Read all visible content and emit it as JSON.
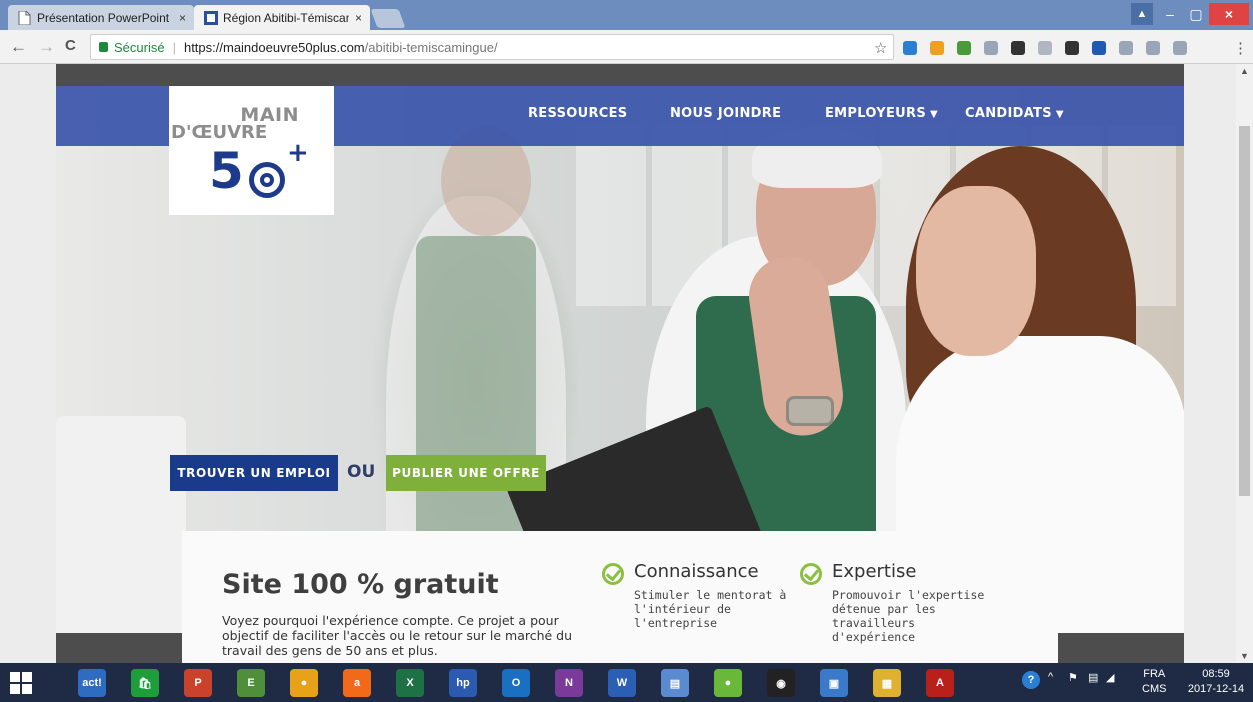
{
  "browser": {
    "tabs": [
      {
        "label": "Présentation PowerPoint",
        "close": "×",
        "active": false
      },
      {
        "label": "Région Abitibi-Témiscam",
        "close": "×",
        "active": true
      }
    ],
    "window_controls": {
      "profile": "▲",
      "minimize": "–",
      "maximize": "▢",
      "close": "×"
    },
    "nav": {
      "back": "←",
      "forward": "→",
      "reload": "C"
    },
    "address": {
      "secure_label": "Sécurisé",
      "separator": "|",
      "url_host": "https://maindoeuvre50plus.com",
      "url_path": "/abitibi-temiscamingue/"
    },
    "bookmark_icon": "☆",
    "menu_icon": "⋮",
    "extension_colors": [
      "#2a7fd4",
      "#f0a020",
      "#4a9a3a",
      "#9aa6b8",
      "#333333",
      "#b0b7c2",
      "#333333",
      "#1e5ab4",
      "#9aa6b8",
      "#9aa6b8",
      "#9aa6b8"
    ]
  },
  "site": {
    "logo": {
      "line1": "MAIN",
      "line2": "D'ŒUVRE",
      "number": "5",
      "plus": "+"
    },
    "nav": [
      {
        "label": "RESSOURCES",
        "has_dropdown": false
      },
      {
        "label": "NOUS JOINDRE",
        "has_dropdown": false
      },
      {
        "label": "EMPLOYEURS",
        "has_dropdown": true
      },
      {
        "label": "CANDIDATS",
        "has_dropdown": true
      }
    ],
    "caret": "▼",
    "cta": {
      "find_job": "TROUVER UN EMPLOI",
      "or": "OU",
      "publish_offer": "PUBLIER UNE OFFRE"
    },
    "card": {
      "title": "Site 100 % gratuit",
      "description": "Voyez pourquoi l'expérience compte. Ce projet a pour objectif de faciliter l'accès ou le retour sur le marché du travail des gens de 50 ans et plus.",
      "features": [
        {
          "name": "Connaissance",
          "description": "Stimuler le mentorat à l'intérieur de l'entreprise"
        },
        {
          "name": "Expertise",
          "description": "Promouvoir l'expertise détenue par les travailleurs d'expérience"
        }
      ]
    },
    "colors": {
      "nav_blue": "#3a54aa",
      "find_button": "#1a3a8c",
      "publish_button": "#7fb03b",
      "check_green": "#8bbf3f"
    }
  },
  "scrollbar": {
    "up": "▲",
    "down": "▼"
  },
  "taskbar": {
    "apps": [
      {
        "name": "act",
        "label": "act!",
        "color": "#2d6cc0"
      },
      {
        "name": "store",
        "label": "🛍",
        "color": "#1e9e3a"
      },
      {
        "name": "powerpoint",
        "label": "P",
        "color": "#c9422b"
      },
      {
        "name": "evernote",
        "label": "E",
        "color": "#4f8f3a"
      },
      {
        "name": "chrome",
        "label": "●",
        "color": "#e8a21a"
      },
      {
        "name": "avast",
        "label": "a",
        "color": "#f06a1a"
      },
      {
        "name": "excel",
        "label": "X",
        "color": "#1e7145"
      },
      {
        "name": "hp",
        "label": "hp",
        "color": "#2a5bb0"
      },
      {
        "name": "outlook",
        "label": "O",
        "color": "#1a6fc0"
      },
      {
        "name": "onenote",
        "label": "N",
        "color": "#7a3a9a"
      },
      {
        "name": "word",
        "label": "W",
        "color": "#2b5fb4"
      },
      {
        "name": "documents",
        "label": "▤",
        "color": "#5a8ad0"
      },
      {
        "name": "messenger",
        "label": "●",
        "color": "#6ab83a"
      },
      {
        "name": "obs",
        "label": "◉",
        "color": "#222222"
      },
      {
        "name": "remote",
        "label": "▣",
        "color": "#3a7ac8"
      },
      {
        "name": "explorer",
        "label": "▦",
        "color": "#e0b030"
      },
      {
        "name": "acrobat",
        "label": "A",
        "color": "#b8201a"
      }
    ],
    "tray": {
      "help": "?",
      "chevron": "^",
      "flag": "⚑",
      "network": "▤",
      "volume": "◢"
    },
    "language": {
      "lang": "FRA",
      "layout": "CMS"
    },
    "clock": {
      "time": "08:59",
      "date": "2017-12-14"
    }
  }
}
